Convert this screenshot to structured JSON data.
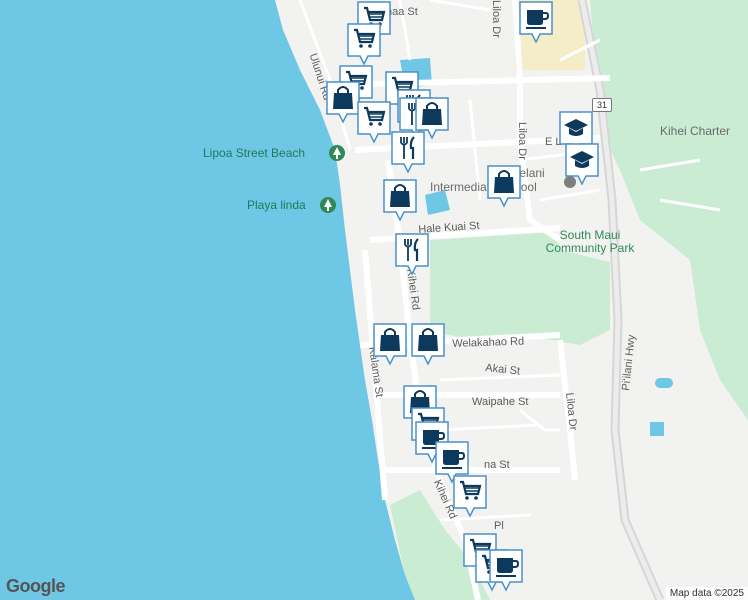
{
  "map": {
    "attribution": "Map data ©2025",
    "logo": "Google",
    "highway_shield": "31",
    "streets": {
      "s1": "Ulunui Rd",
      "s2": "Kulanihakoi St",
      "s3": "Liloa Dr",
      "s4": "Hale Kuai St",
      "s5": "Kihei Rd",
      "s6": "Welakahao Rd",
      "s7": "Kalama St",
      "s8": "Akai St",
      "s9": "Waipahe St",
      "s10": "Liloa Dr",
      "s11": "Pi‘ilani Hwy",
      "s12": "Kihei Rd",
      "s13": "Liloa Dr",
      "s14": "E Lipoa St"
    },
    "pois": {
      "lipoa_beach": "Lipoa Street Beach",
      "playa_linda": "Playa linda",
      "park": "South Maui Community Park",
      "school_a": "Lokelani",
      "school_b": "Intermediate School",
      "kihei_chart": "Kihei Charter"
    }
  },
  "markers": [
    {
      "type": "shopping-cart",
      "icon": "shopping-cart-icon"
    },
    {
      "type": "coffee",
      "icon": "coffee-cup-icon"
    },
    {
      "type": "shopping-cart",
      "icon": "shopping-cart-icon"
    },
    {
      "type": "shopping-cart",
      "icon": "shopping-cart-icon"
    },
    {
      "type": "shopping-bag",
      "icon": "shopping-bag-icon"
    },
    {
      "type": "shopping-cart",
      "icon": "shopping-cart-icon"
    },
    {
      "type": "shopping-cart",
      "icon": "shopping-cart-icon"
    },
    {
      "type": "restaurant",
      "icon": "fork-knife-icon"
    },
    {
      "type": "restaurant",
      "icon": "fork-knife-icon"
    },
    {
      "type": "shopping-bag",
      "icon": "shopping-bag-icon"
    },
    {
      "type": "restaurant",
      "icon": "fork-knife-icon"
    },
    {
      "type": "school",
      "icon": "graduation-cap-icon"
    },
    {
      "type": "school",
      "icon": "graduation-cap-icon"
    },
    {
      "type": "shopping-bag",
      "icon": "shopping-bag-icon"
    },
    {
      "type": "shopping-bag",
      "icon": "shopping-bag-icon"
    },
    {
      "type": "restaurant",
      "icon": "fork-knife-icon"
    },
    {
      "type": "shopping-bag",
      "icon": "shopping-bag-icon"
    },
    {
      "type": "shopping-bag",
      "icon": "shopping-bag-icon"
    },
    {
      "type": "shopping-bag",
      "icon": "shopping-bag-icon"
    },
    {
      "type": "shopping-cart",
      "icon": "shopping-cart-icon"
    },
    {
      "type": "coffee",
      "icon": "coffee-cup-icon"
    },
    {
      "type": "coffee",
      "icon": "coffee-cup-icon"
    },
    {
      "type": "shopping-cart",
      "icon": "shopping-cart-icon"
    },
    {
      "type": "shopping-cart",
      "icon": "shopping-cart-icon"
    },
    {
      "type": "shopping-cart",
      "icon": "shopping-cart-icon"
    },
    {
      "type": "coffee",
      "icon": "coffee-cup-icon"
    }
  ],
  "colors": {
    "water": "#6ec7e4",
    "land": "#f2f3f1",
    "park": "#c9ecd3",
    "marker_fill": "#ffffff",
    "marker_border": "#4a90c8",
    "marker_icon": "#0d3a5c",
    "road": "#ffffff",
    "highway": "#d6d6d6",
    "sand": "#f5ecc8"
  }
}
